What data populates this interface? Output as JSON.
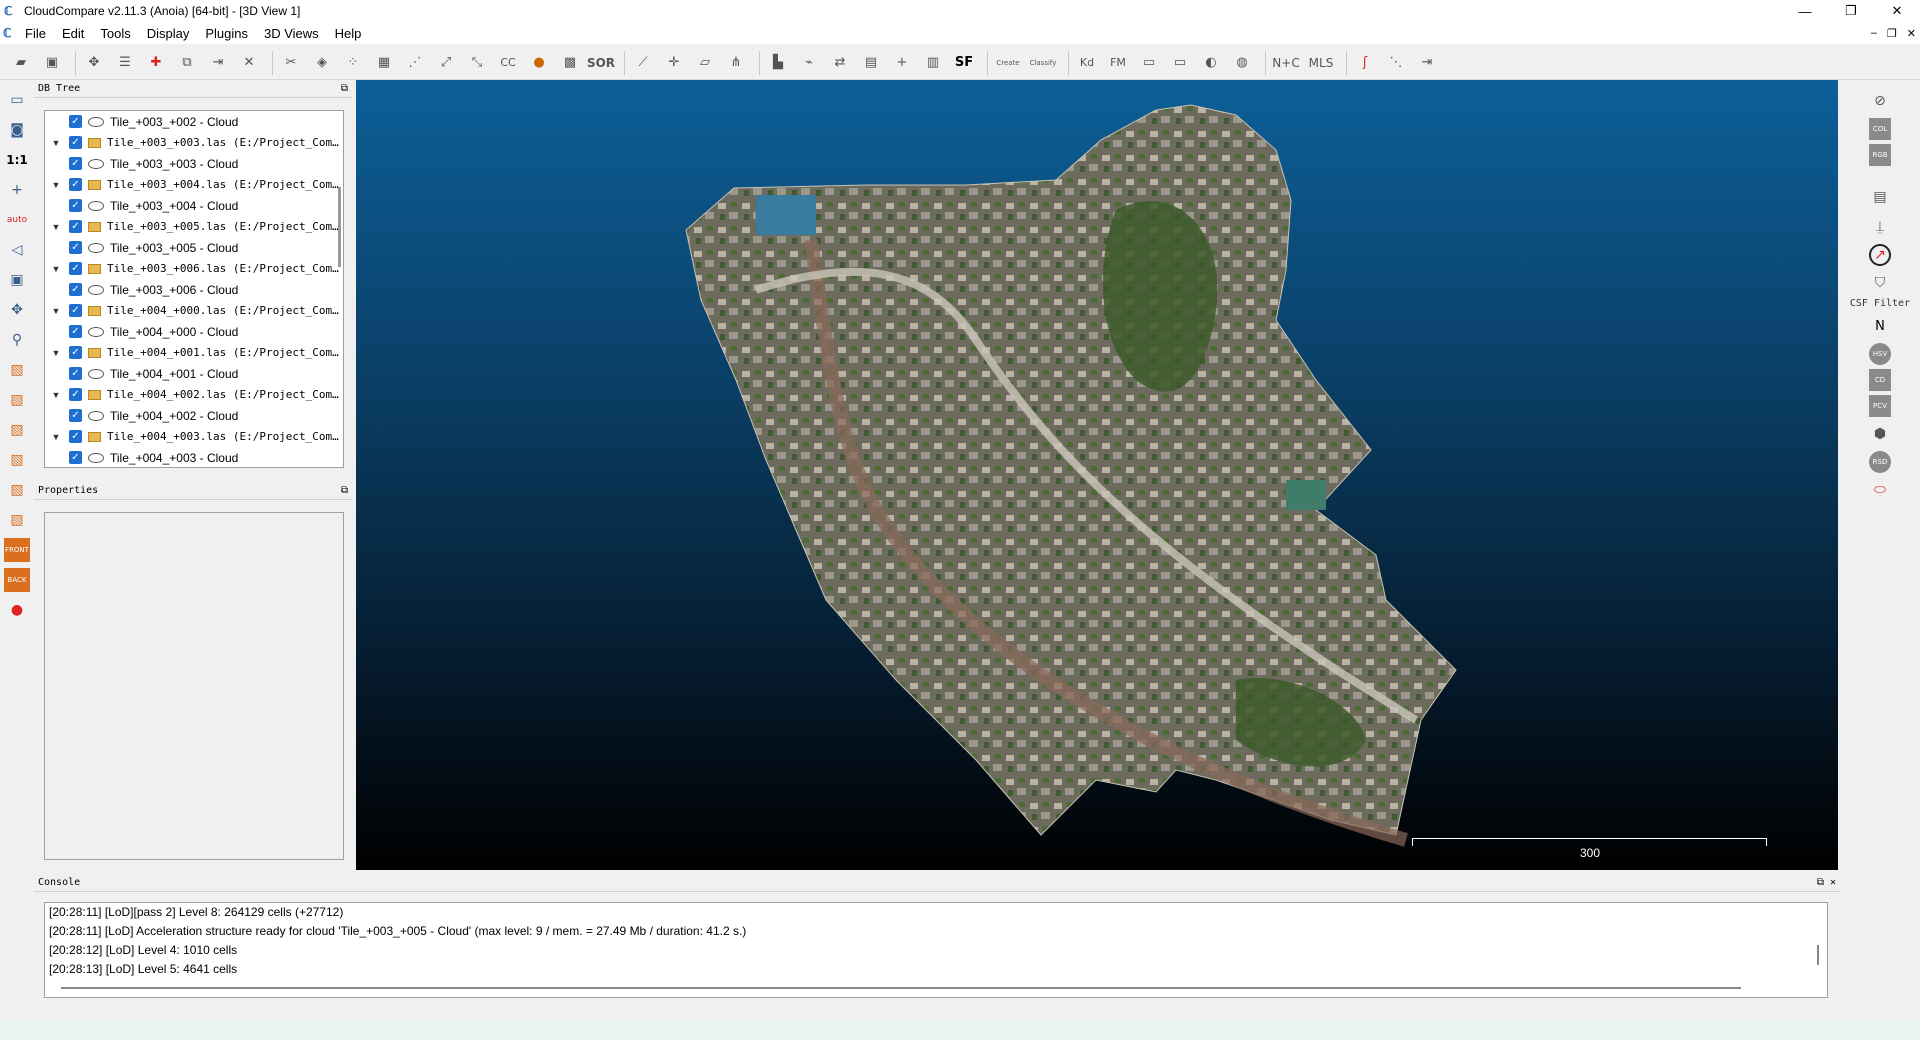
{
  "window": {
    "title": "CloudCompare v2.11.3 (Anoia) [64-bit] - [3D View 1]",
    "minimize_glyph": "—",
    "maximize_glyph": "❐",
    "close_glyph": "✕"
  },
  "menu": {
    "items": [
      "File",
      "Edit",
      "Tools",
      "Display",
      "Plugins",
      "3D Views",
      "Help"
    ],
    "mdi_glyphs": [
      "–",
      "❐",
      "✕"
    ]
  },
  "toolbar": {
    "icons": [
      "open-icon",
      "save-icon",
      "graphical-transform-icon",
      "list-icon",
      "add-point-icon",
      "clone-icon",
      "merge-icon",
      "delete-icon",
      "segment-icon",
      "fill-icon",
      "subsample-icon",
      "normals-icon",
      "octree-icon",
      "register-icon",
      "align-icon",
      "cc-icon",
      "ball-icon",
      "checker-icon",
      "sor-icon",
      "cross-section-icon",
      "translate-icon",
      "plane-icon",
      "split-icon",
      "histogram-icon",
      "kpi-icon",
      "min-max-icon",
      "grid-icon",
      "plus-icon",
      "calculator-icon",
      "sf-icon",
      "canupo-create-icon",
      "canupo-classify-icon",
      "kd-icon",
      "fm-icon",
      "tb1-icon",
      "tb2-icon",
      "sphere-icon",
      "globe-icon",
      "nc-icon",
      "mls-icon",
      "s-icon",
      "s2-icon",
      "export-icon"
    ],
    "text_buttons": {
      "sor": "SOR",
      "sf": "SF",
      "canupo_create": "Create",
      "canupo_classify": "Classify",
      "kd": "Kd",
      "fm": "FM",
      "nc": "N+C",
      "mls": "MLS"
    }
  },
  "left_tools": {
    "ratio_label": "1:1",
    "auto_label": "auto",
    "front_label": "FRONT",
    "back_label": "BACK"
  },
  "db_tree": {
    "title": "DB Tree",
    "rows": [
      {
        "kind": "cloud",
        "label": "Tile_+003_+002 - Cloud"
      },
      {
        "kind": "las",
        "label": "Tile_+003_+003.las (E:/Project_Com…"
      },
      {
        "kind": "cloud",
        "label": "Tile_+003_+003 - Cloud"
      },
      {
        "kind": "las",
        "label": "Tile_+003_+004.las (E:/Project_Com…"
      },
      {
        "kind": "cloud",
        "label": "Tile_+003_+004 - Cloud"
      },
      {
        "kind": "las",
        "label": "Tile_+003_+005.las (E:/Project_Com…"
      },
      {
        "kind": "cloud",
        "label": "Tile_+003_+005 - Cloud"
      },
      {
        "kind": "las",
        "label": "Tile_+003_+006.las (E:/Project_Com…"
      },
      {
        "kind": "cloud",
        "label": "Tile_+003_+006 - Cloud"
      },
      {
        "kind": "las",
        "label": "Tile_+004_+000.las (E:/Project_Com…"
      },
      {
        "kind": "cloud",
        "label": "Tile_+004_+000 - Cloud"
      },
      {
        "kind": "las",
        "label": "Tile_+004_+001.las (E:/Project_Com…"
      },
      {
        "kind": "cloud",
        "label": "Tile_+004_+001 - Cloud"
      },
      {
        "kind": "las",
        "label": "Tile_+004_+002.las (E:/Project_Com…"
      },
      {
        "kind": "cloud",
        "label": "Tile_+004_+002 - Cloud"
      },
      {
        "kind": "las",
        "label": "Tile_+004_+003.las (E:/Project_Com…"
      },
      {
        "kind": "cloud",
        "label": "Tile_+004_+003 - Cloud"
      }
    ]
  },
  "properties": {
    "title": "Properties"
  },
  "view3d": {
    "scale_value": "300",
    "background_top": "#0d5f99",
    "background_bottom": "#000000"
  },
  "right_tools": {
    "csf_label": "CSF Filter",
    "n_label": "N",
    "badges": [
      "COL",
      "RGB",
      "HSV",
      "CD",
      "PCV",
      "RSD"
    ]
  },
  "console": {
    "title": "Console",
    "lines": [
      "[20:28:11] [LoD][pass 2] Level 8: 264129 cells (+27712)",
      "[20:28:11] [LoD] Acceleration structure ready for cloud 'Tile_+003_+005 - Cloud' (max level: 9 / mem. = 27.49 Mb / duration: 41.2 s.)",
      "[20:28:12] [LoD] Level 4: 1010 cells",
      "[20:28:13] [LoD] Level 5: 4641 cells"
    ]
  },
  "colors": {
    "accent": "#1f6fd1",
    "panel_bg": "#f0f0f0"
  }
}
